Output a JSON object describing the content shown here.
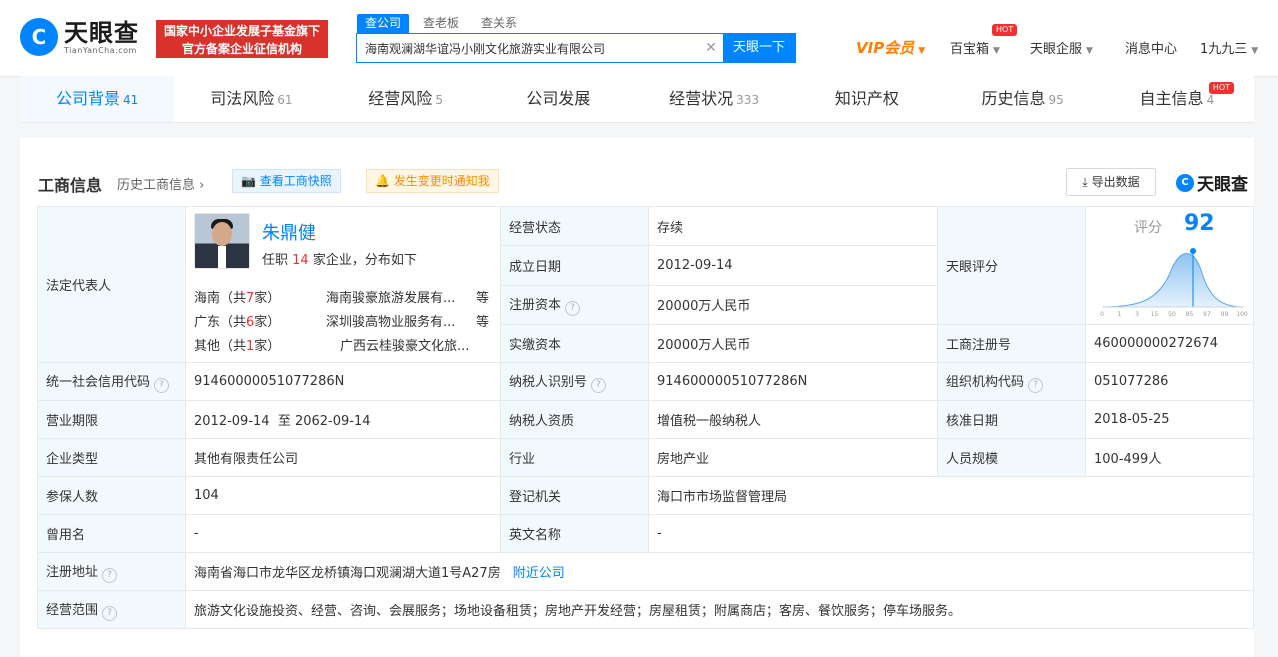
{
  "header": {
    "logo_cn": "天眼查",
    "logo_en": "TianYanCha.com",
    "banner_line1": "国家中小企业发展子基金旗下",
    "banner_line2": "官方备案企业征信机构",
    "search_tabs": [
      "查公司",
      "查老板",
      "查关系"
    ],
    "search_value": "海南观澜湖华谊冯小刚文化旅游实业有限公司",
    "search_button": "天眼一下",
    "nav": {
      "vip": "VIP会员",
      "treasure": "百宝箱",
      "enterprise": "天眼企服",
      "messages": "消息中心",
      "user": "1九九三"
    },
    "hot_badge": "HOT"
  },
  "tabs": [
    {
      "label": "公司背景",
      "count": "41"
    },
    {
      "label": "司法风险",
      "count": "61"
    },
    {
      "label": "经营风险",
      "count": "5"
    },
    {
      "label": "公司发展",
      "count": ""
    },
    {
      "label": "经营状况",
      "count": "333"
    },
    {
      "label": "知识产权",
      "count": ""
    },
    {
      "label": "历史信息",
      "count": "95"
    },
    {
      "label": "自主信息",
      "count": "4"
    }
  ],
  "section": {
    "title": "工商信息",
    "history_link": "历史工商信息",
    "snapshot_button": "查看工商快照",
    "notify_button": "发生变更时通知我",
    "export_button": "导出数据",
    "brand": "天眼查"
  },
  "legal_rep": {
    "label": "法定代表人",
    "name": "朱鼎健",
    "positions_prefix": "任职",
    "positions_count": "14",
    "positions_suffix": "家企业，分布如下",
    "regions": [
      {
        "region": "海南（共",
        "num": "7",
        "end": "家）",
        "company": "海南骏豪旅游发展有...",
        "etc": "等"
      },
      {
        "region": "广东（共",
        "num": "6",
        "end": "家）",
        "company": "深圳骏高物业服务有...",
        "etc": "等"
      },
      {
        "region": "其他（共",
        "num": "1",
        "end": "家）",
        "company": "广西云桂骏豪文化旅...",
        "etc": ""
      }
    ]
  },
  "fields": {
    "status_label": "经营状态",
    "status": "存续",
    "found_label": "成立日期",
    "found": "2012-09-14",
    "regcap_label": "注册资本",
    "regcap": "20000万人民币",
    "paidcap_label": "实缴资本",
    "paidcap": "20000万人民币",
    "score_label": "天眼评分",
    "score_title": "评分",
    "score": "92",
    "score_ticks": [
      "0",
      "1",
      "3",
      "15",
      "50",
      "85",
      "97",
      "99",
      "100"
    ],
    "regno_label": "工商注册号",
    "regno": "460000000272674",
    "credit_label": "统一社会信用代码",
    "credit": "9146000005107728​6N",
    "taxid_label": "纳税人识别号",
    "taxid": "9146000005107728​6N",
    "orgcode_label": "组织机构代码",
    "orgcode": "051077286",
    "term_label": "营业期限",
    "term": "2012-09-14  至 2062-09-14",
    "taxqual_label": "纳税人资质",
    "taxqual": "增值税一般纳税人",
    "approve_label": "核准日期",
    "approve": "2018-05-25",
    "type_label": "企业类型",
    "type": "其他有限责任公司",
    "industry_label": "行业",
    "industry": "房地产业",
    "staff_label": "人员规模",
    "staff": "100-499人",
    "insured_label": "参保人数",
    "insured": "104",
    "authority_label": "登记机关",
    "authority": "海口市市场监督管理局",
    "formername_label": "曾用名",
    "formername": "-",
    "engname_label": "英文名称",
    "engname": "-",
    "address_label": "注册地址",
    "address": "海南省海口市龙华区龙桥镇海口观澜湖大道1号A27房",
    "nearby": "附近公司",
    "scope_label": "经营范围",
    "scope": "旅游文化设施投资、经营、咨询、会展服务；场地设备租赁；房地产开发经营；房屋租赁；附属商店；客房、餐饮服务；停车场服务。"
  },
  "colors": {
    "accent": "#0084ff",
    "red": "#d9312b",
    "vip": "#ff7f00"
  }
}
